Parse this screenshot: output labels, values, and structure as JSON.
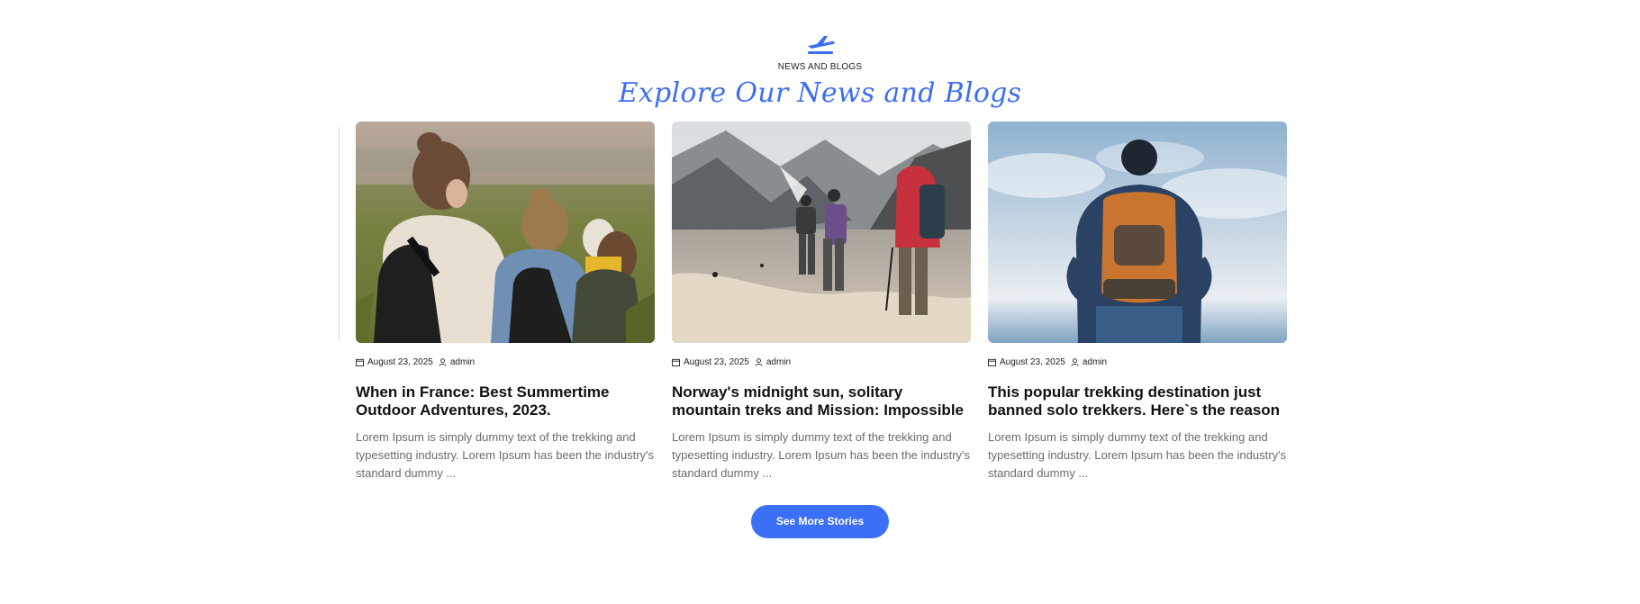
{
  "section": {
    "icon": "airplane-takeoff-icon",
    "eyebrow": "NEWS AND BLOGS",
    "title": "Explore Our News and Blogs"
  },
  "posts": [
    {
      "image": "friends-in-meadow-photo",
      "date": "August 23, 2025",
      "author": "admin",
      "title": "When in France: Best Summertime Outdoor Adventures, 2023.",
      "excerpt": "Lorem Ipsum is simply dummy text of the trekking and typesetting industry. Lorem Ipsum has been the industry's standard dummy ..."
    },
    {
      "image": "mountain-trekkers-photo",
      "date": "August 23, 2025",
      "author": "admin",
      "title": "Norway's midnight sun, solitary mountain treks and Mission: Impossible",
      "excerpt": "Lorem Ipsum is simply dummy text of the trekking and typesetting industry. Lorem Ipsum has been the industry's standard dummy ..."
    },
    {
      "image": "backpacker-sky-photo",
      "date": "August 23, 2025",
      "author": "admin",
      "title": "This popular trekking destination just banned solo trekkers. Here`s the reason",
      "excerpt": "Lorem Ipsum is simply dummy text of the trekking and typesetting industry. Lorem Ipsum has been the industry's standard dummy ..."
    }
  ],
  "cta": {
    "label": "See More Stories"
  },
  "colors": {
    "accent": "#3b6ff5",
    "title": "#111111",
    "excerpt": "#6b6b6b"
  }
}
